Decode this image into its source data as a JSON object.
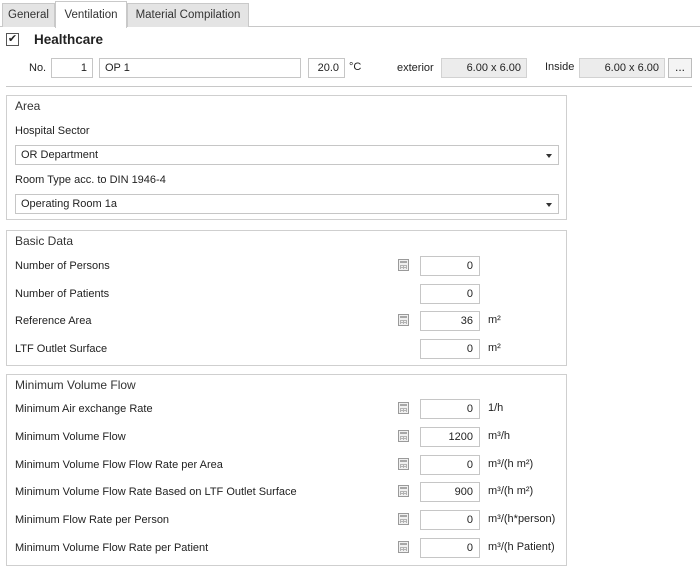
{
  "tabs": [
    {
      "label": "General",
      "active": false
    },
    {
      "label": "Ventilation",
      "active": true
    },
    {
      "label": "Material Compilation",
      "active": false
    }
  ],
  "header": {
    "checked": true,
    "check_glyph": "✔",
    "title": "Healthcare"
  },
  "room": {
    "no_label": "No.",
    "number": "1",
    "name": "OP 1",
    "temperature": "20.0",
    "temp_unit": "°C",
    "exterior_label": "exterior",
    "exterior_value": "6.00 x 6.00",
    "inside_label": "Inside",
    "inside_value": "6.00 x 6.00",
    "more_button": "..."
  },
  "area": {
    "title": "Area",
    "sector_label": "Hospital Sector",
    "sector_value": "OR Department",
    "room_type_label": "Room Type acc. to DIN 1946-4",
    "room_type_value": "Operating Room 1a"
  },
  "basic": {
    "title": "Basic Data",
    "rows": [
      {
        "label": "Number of Persons",
        "value": "0",
        "unit": "",
        "calc": true
      },
      {
        "label": "Number of Patients",
        "value": "0",
        "unit": "",
        "calc": false
      },
      {
        "label": "Reference Area",
        "value": "36",
        "unit": "m²",
        "calc": true
      },
      {
        "label": "LTF Outlet Surface",
        "value": "0",
        "unit": "m²",
        "calc": false
      }
    ]
  },
  "minflow": {
    "title": "Minimum Volume Flow",
    "rows": [
      {
        "label": "Minimum Air exchange Rate",
        "value": "0",
        "unit": "1/h",
        "calc": true
      },
      {
        "label": "Minimum Volume Flow",
        "value": "1200",
        "unit": "m³/h",
        "calc": true
      },
      {
        "label": "Minimum Volume Flow Flow Rate per Area",
        "value": "0",
        "unit": "m³/(h m²)",
        "calc": true
      },
      {
        "label": "Minimum Volume Flow Rate Based on LTF Outlet Surface",
        "value": "900",
        "unit": "m³/(h m²)",
        "calc": true
      },
      {
        "label": "Minimum Flow Rate per Person",
        "value": "0",
        "unit": "m³/(h*person)",
        "calc": true
      },
      {
        "label": "Minimum Volume Flow Rate per Patient",
        "value": "0",
        "unit": "m³/(h Patient)",
        "calc": true
      }
    ]
  },
  "icons": {
    "calculator": "calculator-icon",
    "dropdown": "chevron-down-icon",
    "check": "check-icon"
  }
}
